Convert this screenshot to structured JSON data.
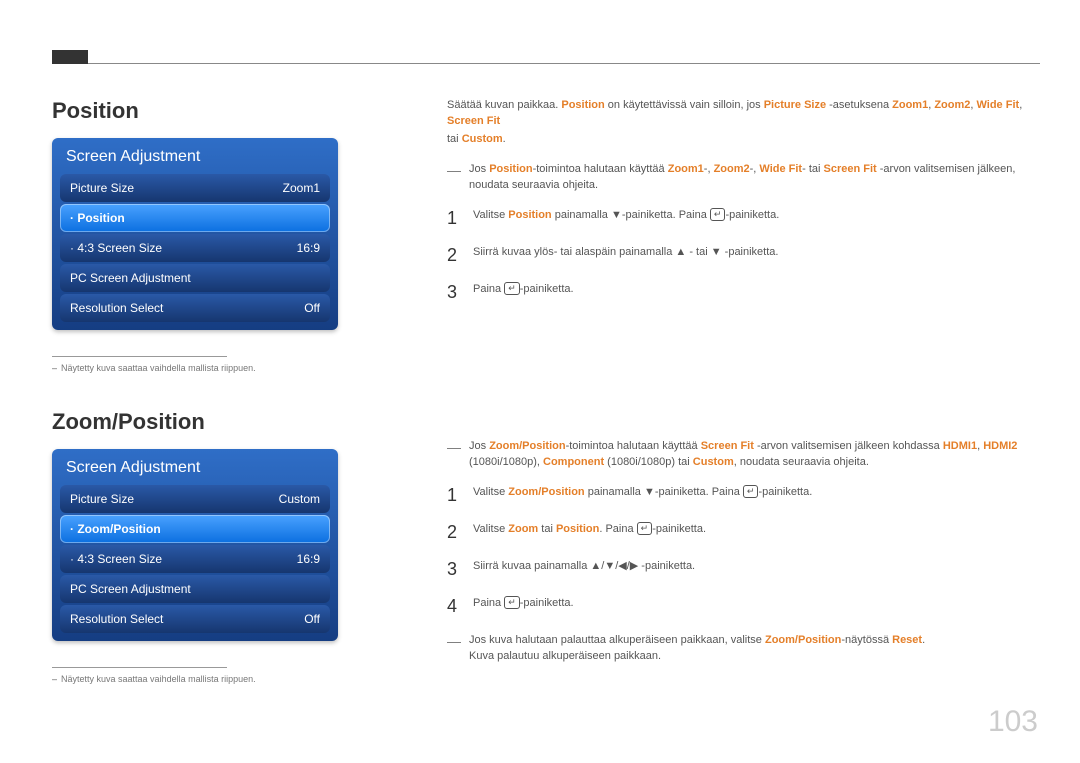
{
  "page_number": "103",
  "sections": {
    "position": {
      "heading": "Position",
      "menu": {
        "title": "Screen Adjustment",
        "rows": [
          {
            "label": "Picture Size",
            "value": "Zoom1",
            "selected": false
          },
          {
            "label": "· Position",
            "value": "",
            "selected": true
          },
          {
            "label": "· 4:3 Screen Size",
            "value": "16:9",
            "selected": false
          },
          {
            "label": "PC Screen Adjustment",
            "value": "",
            "selected": false
          },
          {
            "label": "Resolution Select",
            "value": "Off",
            "selected": false
          }
        ]
      },
      "footnote": "Näytetty kuva saattaa vaihdella mallista riippuen.",
      "intro_parts": {
        "t1": "Säätää kuvan paikkaa. ",
        "h1": "Position",
        "t2": " on käytettävissä vain silloin, jos ",
        "h2": "Picture Size",
        "t3": " -asetuksena ",
        "h3": "Zoom1",
        "t4": ", ",
        "h4": "Zoom2",
        "t5": ", ",
        "h5": "Wide Fit",
        "t6": ", ",
        "h6": "Screen Fit",
        "t7": "tai ",
        "h7": "Custom",
        "t8": "."
      },
      "note_parts": {
        "t1": "Jos ",
        "h1": "Position",
        "t2": "-toimintoa halutaan käyttää ",
        "h2": "Zoom1",
        "t3": "-, ",
        "h3": "Zoom2",
        "t4": "-, ",
        "h4": "Wide Fit",
        "t5": "- tai ",
        "h5": "Screen Fit",
        "t6": " -arvon valitsemisen jälkeen, noudata seuraavia ohjeita."
      },
      "steps": [
        {
          "num": "1",
          "pre": "Valitse ",
          "hl": "Position",
          "mid": " painamalla ▼-painiketta. Paina ",
          "icon": "↵",
          "suf": "-painiketta."
        },
        {
          "num": "2",
          "text": "Siirrä kuvaa ylös- tai alaspäin painamalla ▲ - tai ▼ -painiketta."
        },
        {
          "num": "3",
          "pre": "Paina ",
          "icon": "↵",
          "suf": "-painiketta."
        }
      ]
    },
    "zoom_position": {
      "heading": "Zoom/Position",
      "menu": {
        "title": "Screen Adjustment",
        "rows": [
          {
            "label": "Picture Size",
            "value": "Custom",
            "selected": false
          },
          {
            "label": "· Zoom/Position",
            "value": "",
            "selected": true
          },
          {
            "label": "· 4:3 Screen Size",
            "value": "16:9",
            "selected": false
          },
          {
            "label": "PC Screen Adjustment",
            "value": "",
            "selected": false
          },
          {
            "label": "Resolution Select",
            "value": "Off",
            "selected": false
          }
        ]
      },
      "footnote": "Näytetty kuva saattaa vaihdella mallista riippuen.",
      "note1_parts": {
        "t1": "Jos ",
        "h1": "Zoom/Position",
        "t2": "-toimintoa halutaan käyttää ",
        "h2": "Screen Fit",
        "t3": " -arvon valitsemisen jälkeen kohdassa ",
        "h3": "HDMI1",
        "t4": ", ",
        "h4": "HDMI2",
        "t5": "(1080i/1080p), ",
        "h5": "Component",
        "t6": " (1080i/1080p) tai ",
        "h6": "Custom",
        "t7": ", noudata seuraavia ohjeita."
      },
      "steps": [
        {
          "num": "1",
          "pre": "Valitse ",
          "hl": "Zoom/Position",
          "mid": " painamalla ▼-painiketta. Paina ",
          "icon": "↵",
          "suf": "-painiketta."
        },
        {
          "num": "2",
          "pre": "Valitse ",
          "hl": "Zoom",
          "mid": " tai ",
          "hl2": "Position",
          "mid2": ". Paina ",
          "icon": "↵",
          "suf": "-painiketta."
        },
        {
          "num": "3",
          "text": "Siirrä kuvaa painamalla ▲/▼/◀/▶ -painiketta."
        },
        {
          "num": "4",
          "pre": "Paina ",
          "icon": "↵",
          "suf": "-painiketta."
        }
      ],
      "note2_parts": {
        "t1": "Jos kuva halutaan palauttaa alkuperäiseen paikkaan, valitse ",
        "h1": "Zoom/Position",
        "t2": "-näytössä ",
        "h2": "Reset",
        "t3": ".",
        "t4": "Kuva palautuu alkuperäiseen paikkaan."
      }
    }
  }
}
